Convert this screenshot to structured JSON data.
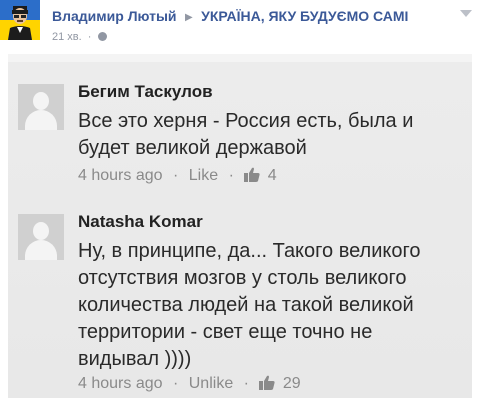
{
  "post": {
    "author": "Владимир Лютый",
    "group": "УКРАЇНА, ЯКУ БУДУЄМО САМІ",
    "time": "21 хв.",
    "separator": "·",
    "header_arrow": "▶"
  },
  "screenshot": {
    "comments": [
      {
        "name": "Бегим Таскулов",
        "lines": [
          "Все это херня - Россия есть, была и",
          "будет великой державой"
        ],
        "time": "4 hours ago",
        "action": "Like",
        "likes": "4"
      },
      {
        "name": "Natasha  Komar",
        "lines": [
          "Ну, в принципе, да... Такого великого",
          "отсутствия мозгов у столь великого",
          "количества людей на такой великой",
          "территории - свет еще точно не",
          "видывал ))))"
        ],
        "time": "4 hours ago",
        "action": "Unlike",
        "likes": "29"
      }
    ],
    "dot": "·"
  },
  "colors": {
    "link": "#3b5998",
    "muted": "#9197a3",
    "flag_blue": "#2c6ec9",
    "flag_yellow": "#ffd400"
  }
}
